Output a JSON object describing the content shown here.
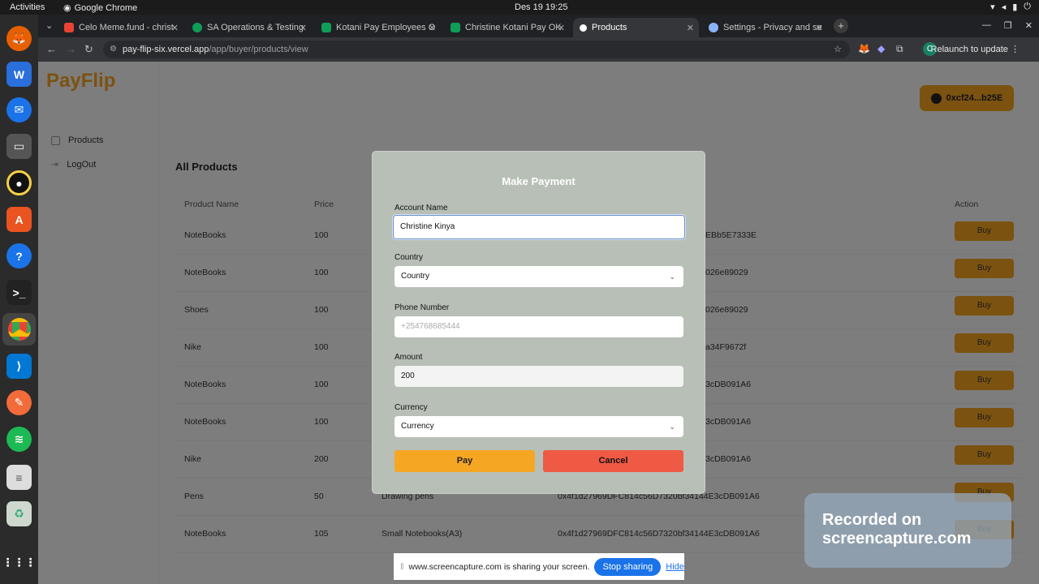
{
  "os": {
    "activities": "Activities",
    "app_name": "Google Chrome",
    "clock": "Des 19  19:25"
  },
  "browser": {
    "tabs": [
      {
        "label": "Celo Meme.fund - christ",
        "color": "#ea4335"
      },
      {
        "label": "SA Operations & Testing",
        "color": "#0f9d58"
      },
      {
        "label": "Kotani Pay Employees O",
        "color": "#0f9d58"
      },
      {
        "label": "Christine Kotani Pay OK",
        "color": "#0f9d58"
      },
      {
        "label": "Products",
        "color": "#ffffff"
      },
      {
        "label": "Settings - Privacy and se",
        "color": "#8ab4f8"
      }
    ],
    "url_host": "pay-flip-six.vercel.app",
    "url_path": "/app/buyer/products/view",
    "profile_initial": "C",
    "relaunch": "Relaunch to update"
  },
  "app": {
    "logo": "PayFlip",
    "nav": [
      {
        "label": "Products"
      },
      {
        "label": "LogOut"
      }
    ],
    "wallet": "0xcf24...b25E",
    "heading": "All Products",
    "columns": {
      "name": "Product Name",
      "price": "Price",
      "action": "Action"
    },
    "rows": [
      {
        "name": "NoteBooks",
        "price": "100",
        "desc": "",
        "addr": "EBb5E7333E",
        "buy": "Buy"
      },
      {
        "name": "NoteBooks",
        "price": "100",
        "desc": "",
        "addr": "026e89029",
        "buy": "Buy"
      },
      {
        "name": "Shoes",
        "price": "100",
        "desc": "",
        "addr": "026e89029",
        "buy": "Buy"
      },
      {
        "name": "Nike",
        "price": "100",
        "desc": "",
        "addr": "a34F9672f",
        "buy": "Buy"
      },
      {
        "name": "NoteBooks",
        "price": "100",
        "desc": "",
        "addr": "3cDB091A6",
        "buy": "Buy"
      },
      {
        "name": "NoteBooks",
        "price": "100",
        "desc": "",
        "addr": "3cDB091A6",
        "buy": "Buy"
      },
      {
        "name": "Nike",
        "price": "200",
        "desc": "",
        "addr": "3cDB091A6",
        "buy": "Buy"
      },
      {
        "name": "Pens",
        "price": "50",
        "desc": "Drawing pens",
        "addr": "0x4f1d27969DFC814c56D7320bf34144E3cDB091A6",
        "buy": "Buy"
      },
      {
        "name": "NoteBooks",
        "price": "105",
        "desc": "Small Notebooks(A3)",
        "addr": "0x4f1d27969DFC814c56D7320bf34144E3cDB091A6",
        "buy": "Buy"
      }
    ]
  },
  "modal": {
    "title": "Make Payment",
    "account_label": "Account Name",
    "account_value": "Christine Kinya",
    "country_label": "Country",
    "country_value": "Country",
    "phone_label": "Phone Number",
    "phone_placeholder": "+254768685444",
    "amount_label": "Amount",
    "amount_value": "200",
    "currency_label": "Currency",
    "currency_value": "Currency",
    "pay": "Pay",
    "cancel": "Cancel",
    "pay_color": "#f5a623",
    "cancel_color": "#ef5a44"
  },
  "watermark": {
    "line1": "Recorded on",
    "line2": "screencapture.com"
  },
  "share_bar": {
    "text": "www.screencapture.com is sharing your screen.",
    "stop": "Stop sharing",
    "hide": "Hide"
  }
}
